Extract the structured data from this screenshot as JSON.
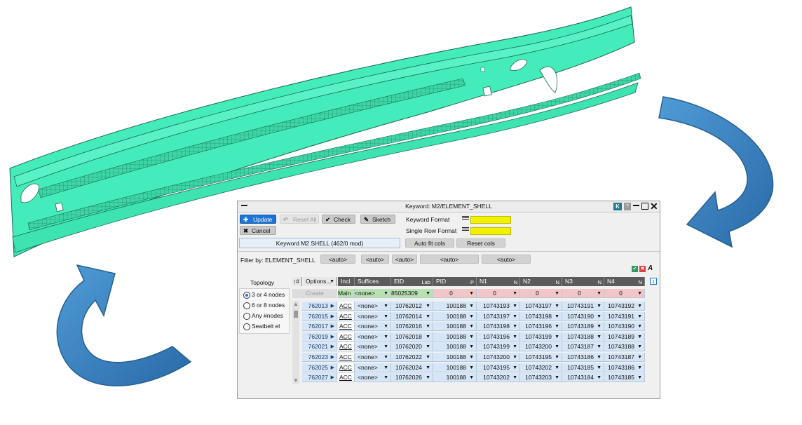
{
  "dialog": {
    "title": "Keyword: M2/ELEMENT_SHELL",
    "title_k": "K",
    "title_help": "?",
    "update": "Update",
    "reset_all": "Reset All",
    "check": "Check",
    "sketch": "Sketch",
    "cancel": "Cancel",
    "keyword_format": "Keyword Format",
    "single_row_format": "Single Row Format",
    "keyword_summary": "Keyword M2 SHELL (462/0 mod)",
    "auto_fit_cols": "Auto fit cols",
    "reset_cols": "Reset cols",
    "filter_label": "Filter by: ELEMENT_SHELL",
    "filters": [
      "<auto>",
      "<auto>",
      "<auto>",
      "<auto>",
      "<auto>"
    ],
    "page_indicator": "1",
    "topology_label": "Topology",
    "topology_options": [
      "3 or 4 nodes",
      "6 or 8 nodes",
      "Any #nodes",
      "Seatbelt el"
    ],
    "topology_selected": 0,
    "accent_color": "#1d73d6"
  },
  "table": {
    "col_hash": "↕#",
    "options": "Options...",
    "headers": [
      {
        "label": "Incl",
        "sub": ""
      },
      {
        "label": "Suffices",
        "sub": ""
      },
      {
        "label": "EID",
        "sub": "Lab"
      },
      {
        "label": "PID",
        "sub": "P"
      },
      {
        "label": "N1",
        "sub": "N"
      },
      {
        "label": "N2",
        "sub": "N"
      },
      {
        "label": "N3",
        "sub": "N"
      },
      {
        "label": "N4",
        "sub": "N"
      }
    ],
    "create_row": {
      "label": "Create",
      "incl": "Main",
      "suffix": "<none>",
      "eid": "85025309",
      "pid": "0",
      "n1": "0",
      "n2": "0",
      "n3": "0",
      "n4": "0"
    },
    "rows": [
      {
        "id": "762013",
        "incl": "ACC",
        "suffix": "<none>",
        "eid": "10762012",
        "pid": "100188",
        "n1": "10743193",
        "n2": "10743197",
        "n3": "10743191",
        "n4": "10743192"
      },
      {
        "id": "762015",
        "incl": "ACC",
        "suffix": "<none>",
        "eid": "10762014",
        "pid": "100188",
        "n1": "10743197",
        "n2": "10743198",
        "n3": "10743190",
        "n4": "10743191"
      },
      {
        "id": "762017",
        "incl": "ACC",
        "suffix": "<none>",
        "eid": "10762016",
        "pid": "100188",
        "n1": "10743198",
        "n2": "10743196",
        "n3": "10743189",
        "n4": "10743190"
      },
      {
        "id": "762019",
        "incl": "ACC",
        "suffix": "<none>",
        "eid": "10762018",
        "pid": "100188",
        "n1": "10743196",
        "n2": "10743199",
        "n3": "10743188",
        "n4": "10743189"
      },
      {
        "id": "762021",
        "incl": "ACC",
        "suffix": "<none>",
        "eid": "10762020",
        "pid": "100188",
        "n1": "10743199",
        "n2": "10743200",
        "n3": "10743187",
        "n4": "10743188"
      },
      {
        "id": "762023",
        "incl": "ACC",
        "suffix": "<none>",
        "eid": "10762022",
        "pid": "100188",
        "n1": "10743200",
        "n2": "10743195",
        "n3": "10743186",
        "n4": "10743187"
      },
      {
        "id": "762025",
        "incl": "ACC",
        "suffix": "<none>",
        "eid": "10762024",
        "pid": "100188",
        "n1": "10743195",
        "n2": "10743202",
        "n3": "10743185",
        "n4": "10743186"
      },
      {
        "id": "762027",
        "incl": "ACC",
        "suffix": "<none>",
        "eid": "10762026",
        "pid": "100188",
        "n1": "10743202",
        "n2": "10743203",
        "n3": "10743184",
        "n4": "10743185"
      }
    ]
  },
  "scene": {
    "model_color": "#40e8b4",
    "arrow_color": "#3a86c4"
  }
}
